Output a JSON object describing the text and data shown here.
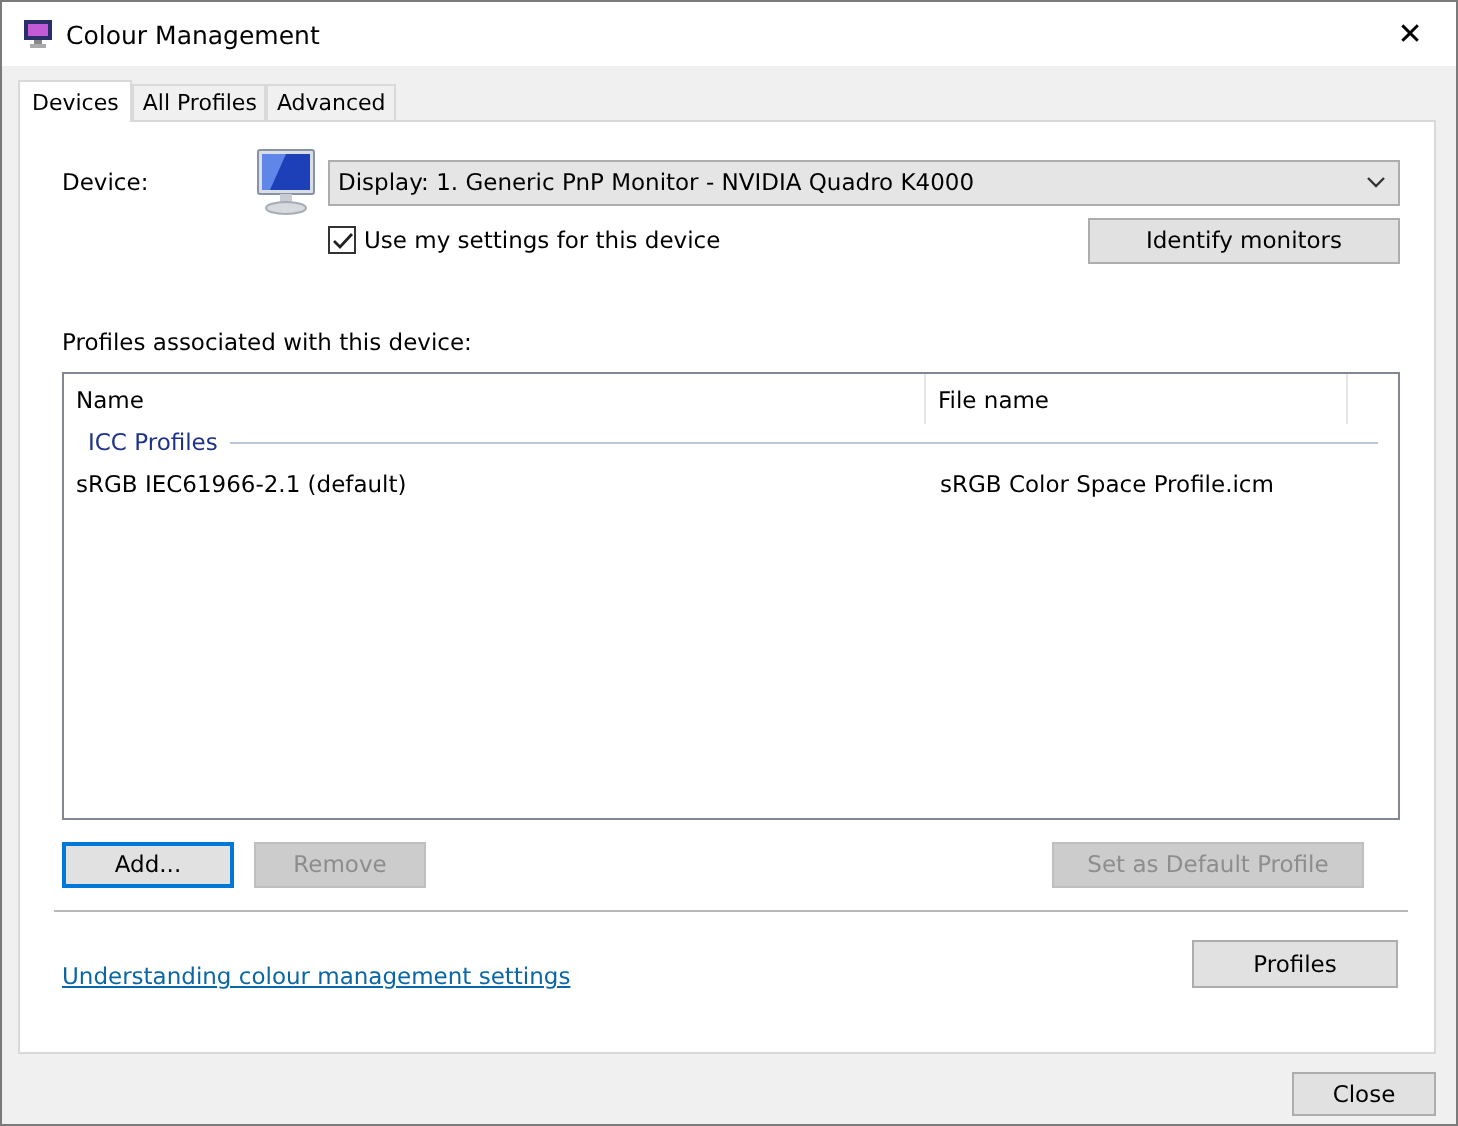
{
  "window": {
    "title": "Colour Management",
    "close": "✕"
  },
  "tabs": [
    {
      "label": "Devices",
      "selected": true
    },
    {
      "label": "All Profiles",
      "selected": false
    },
    {
      "label": "Advanced",
      "selected": false
    }
  ],
  "device": {
    "label": "Device:",
    "value": "Display: 1. Generic PnP Monitor - NVIDIA Quadro K4000",
    "use_settings": {
      "label": "Use my settings for this device",
      "checked": true
    },
    "identify_button": "Identify monitors"
  },
  "profiles": {
    "label": "Profiles associated with this device:",
    "columns": [
      "Name",
      "File name"
    ],
    "groups": [
      {
        "title": "ICC Profiles",
        "rows": [
          {
            "name": "sRGB IEC61966-2.1 (default)",
            "file": "sRGB Color Space Profile.icm"
          }
        ]
      }
    ]
  },
  "profile_buttons": [
    {
      "label": "Add...",
      "disabled": false,
      "focused": true
    },
    {
      "label": "Remove",
      "disabled": true,
      "focused": false
    },
    {
      "label": "Set as Default Profile",
      "disabled": true,
      "focused": false
    }
  ],
  "link": "Understanding colour management settings",
  "profiles_button": "Profiles",
  "close_button": "Close"
}
